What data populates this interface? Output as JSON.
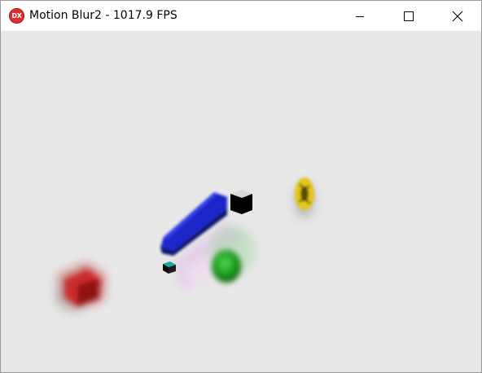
{
  "window": {
    "title": "Motion Blur2 - 1017.9 FPS",
    "app_icon_text": "DX",
    "app_icon_color": "#d8302f",
    "caption_buttons": [
      "minimize",
      "maximize",
      "close"
    ]
  },
  "scene": {
    "background_color": "#e8e8e8",
    "objects": [
      {
        "name": "red-cube",
        "color": "#c81a1a"
      },
      {
        "name": "blue-box",
        "color": "#1a2bd0"
      },
      {
        "name": "black-cube",
        "color": "#111111"
      },
      {
        "name": "cyan-cube",
        "color": "#1a1a1a"
      },
      {
        "name": "green-sphere",
        "color": "#22aa22"
      },
      {
        "name": "yellow-torus",
        "color": "#e8c81a"
      }
    ]
  }
}
